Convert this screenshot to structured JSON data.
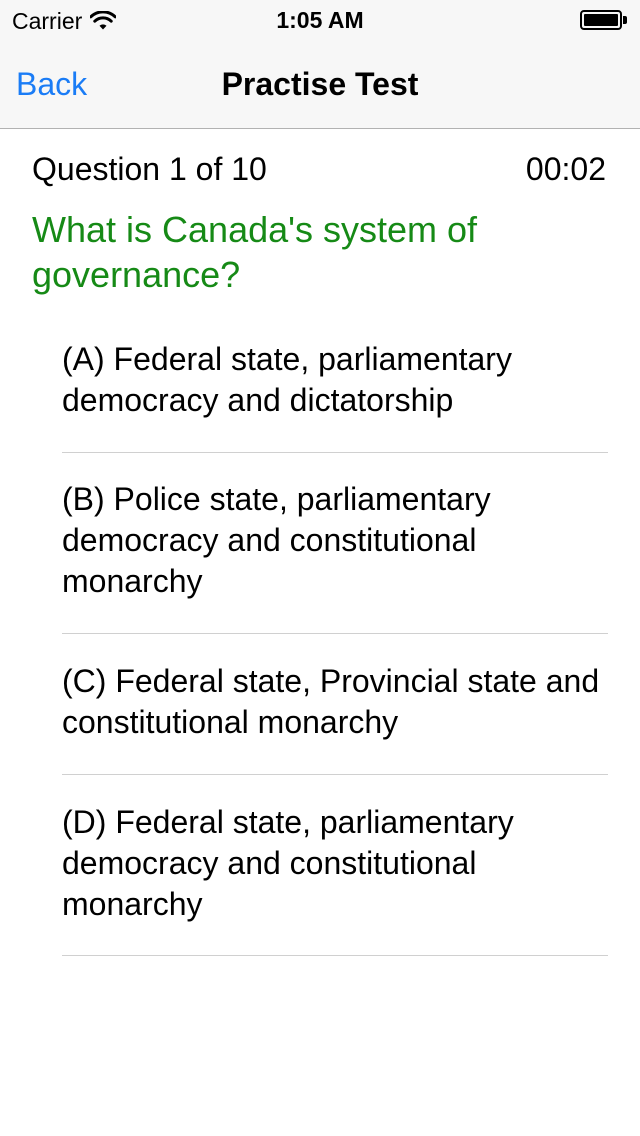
{
  "status_bar": {
    "carrier": "Carrier",
    "time": "1:05 AM",
    "wifi_icon": "wifi-icon",
    "battery_icon": "battery-icon"
  },
  "nav": {
    "back_label": "Back",
    "title": "Practise Test"
  },
  "quiz": {
    "counter": "Question 1 of 10",
    "timer": "00:02",
    "question": "What is Canada's system of governance?",
    "question_color": "#168a16",
    "answers": [
      {
        "label": "(A) Federal state, parliamentary democracy and dictatorship"
      },
      {
        "label": "(B) Police state, parliamentary democracy and constitutional monarchy"
      },
      {
        "label": "(C) Federal state, Provincial state and constitutional monarchy"
      },
      {
        "label": "(D) Federal state, parliamentary democracy and constitutional monarchy"
      }
    ]
  },
  "colors": {
    "accent": "#1a7cf6",
    "nav_background": "#f7f7f7",
    "separator": "#d0d0d0"
  }
}
